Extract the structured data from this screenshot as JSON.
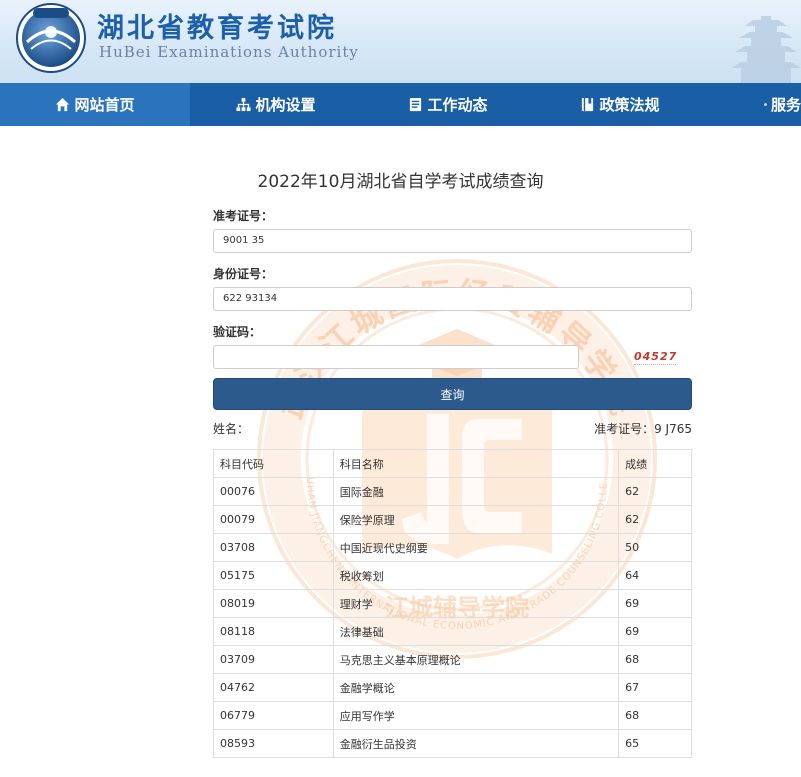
{
  "header": {
    "title": "湖北省教育考试院",
    "subtitle": "HuBei Examinations Authority"
  },
  "nav": {
    "items": [
      {
        "label": "网站首页",
        "icon": "home-icon",
        "active": true
      },
      {
        "label": "机构设置",
        "icon": "org-chart-icon",
        "active": false
      },
      {
        "label": "工作动态",
        "icon": "document-icon",
        "active": false
      },
      {
        "label": "政策法规",
        "icon": "book-icon",
        "active": false
      },
      {
        "label": "服务",
        "icon": "compass-icon",
        "active": false
      }
    ]
  },
  "watermark": {
    "top_text": "武汉江城国际经贸辅导学院",
    "middle_text": "江城辅导学院",
    "bottom_text": "WUHAN JIANGCHENG INTERNATIONAL ECONOMIC AND TRADE COUNSELING COLLEGE",
    "color": "#f29a54"
  },
  "page_title": "2022年10月湖北省自学考试成绩查询",
  "form": {
    "exam_no_label": "准考证号：",
    "exam_no_value": "9001          35",
    "id_no_label": "身份证号：",
    "id_no_value": "622            93134",
    "captcha_label": "验证码：",
    "captcha_value": "",
    "captcha_image_text": "04527",
    "query_button": "查询"
  },
  "result_info": {
    "name_label": "姓名：",
    "name_value": "",
    "exam_no_label": "准考证号：",
    "exam_no_value": "9          J765"
  },
  "table": {
    "headers": [
      "科目代码",
      "科目名称",
      "成绩"
    ],
    "rows": [
      [
        "00076",
        "国际金融",
        "62"
      ],
      [
        "00079",
        "保险学原理",
        "62"
      ],
      [
        "03708",
        "中国近现代史纲要",
        "50"
      ],
      [
        "05175",
        "税收筹划",
        "64"
      ],
      [
        "08019",
        "理财学",
        "69"
      ],
      [
        "08118",
        "法律基础",
        "69"
      ],
      [
        "03709",
        "马克思主义基本原理概论",
        "68"
      ],
      [
        "04762",
        "金融学概论",
        "67"
      ],
      [
        "06779",
        "应用写作学",
        "68"
      ],
      [
        "08593",
        "金融衍生品投资",
        "65"
      ]
    ]
  },
  "colors": {
    "nav_bg": "#1a5ea5",
    "nav_active": "#2b74bd",
    "title_blue": "#1c5faa",
    "button_bg": "#2c5a8c"
  }
}
